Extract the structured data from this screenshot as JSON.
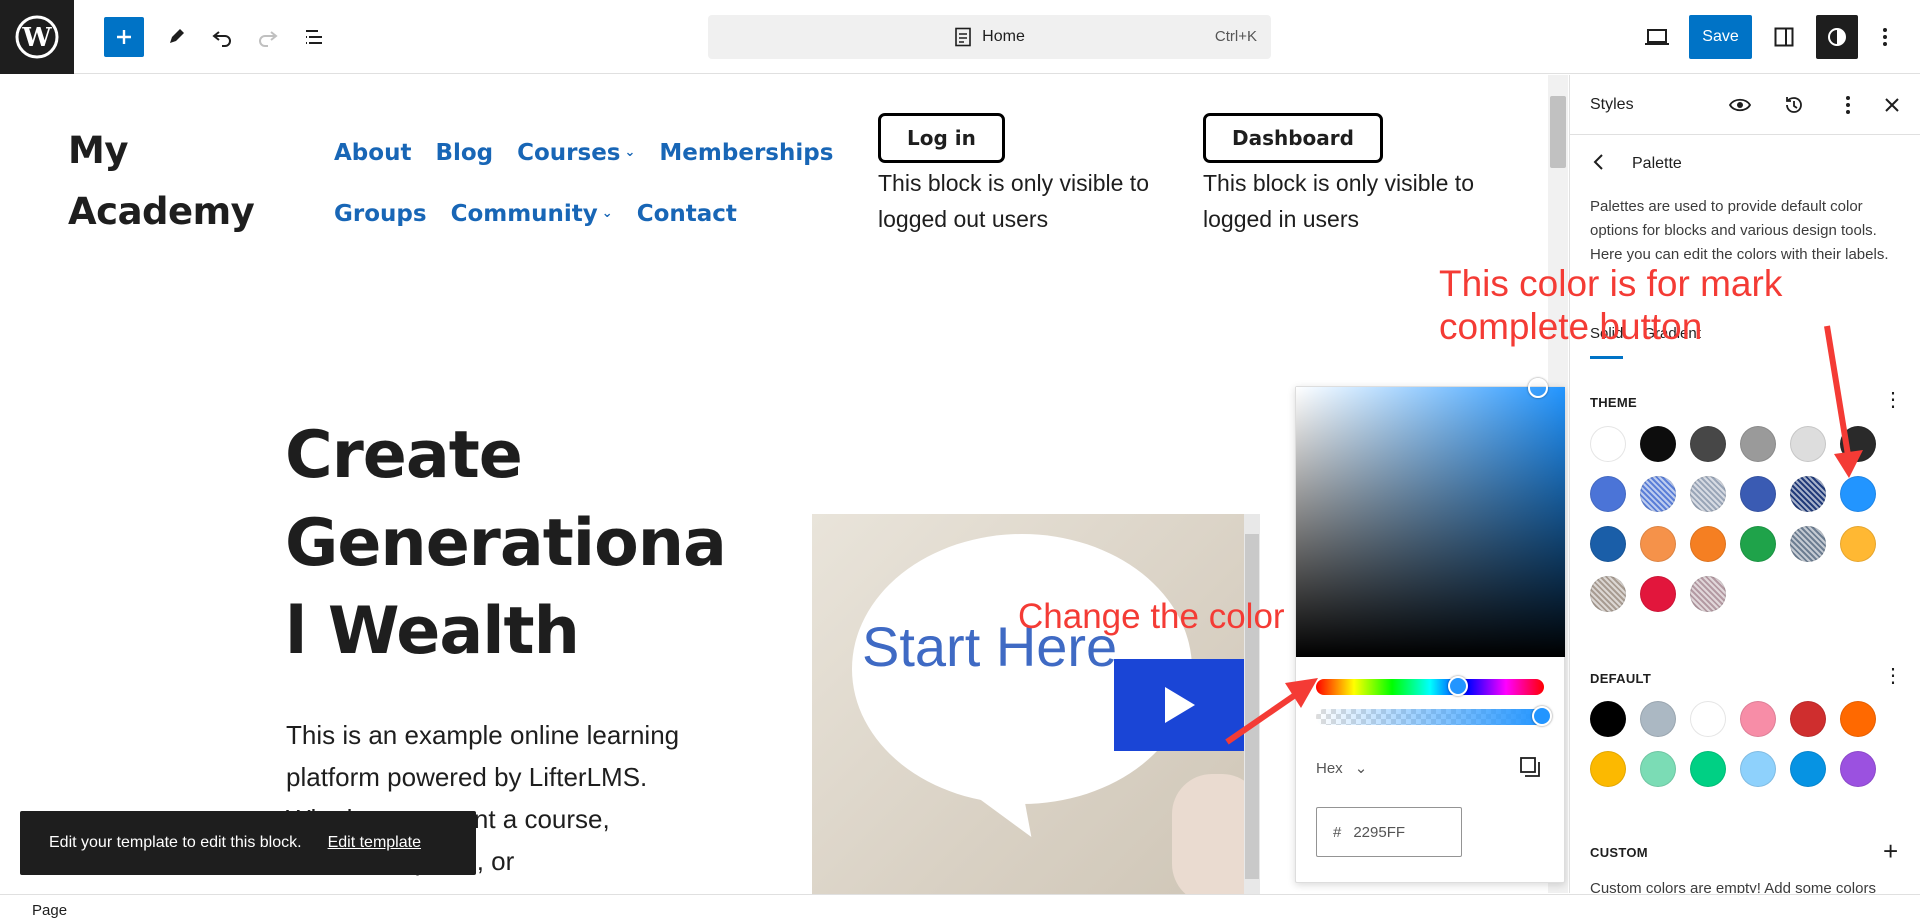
{
  "topbar": {
    "doc_title": "Home",
    "shortcut": "Ctrl+K",
    "save_label": "Save"
  },
  "site": {
    "title_line1": "My",
    "title_line2": "Academy",
    "nav_row1": [
      "About",
      "Blog",
      "Courses",
      "Memberships"
    ],
    "nav_row2": [
      "Groups",
      "Community",
      "Contact"
    ],
    "login_button": "Log in",
    "login_note_line1": "This block is only visible to",
    "login_note_line2": "logged out users",
    "dashboard_button": "Dashboard",
    "dashboard_note_line1": "This block is only visible to",
    "dashboard_note_line2": "logged in users"
  },
  "hero": {
    "title_line1": "Create",
    "title_line2": "Generationa",
    "title_line3": "l Wealth",
    "text_line1": "This is an example online learning",
    "text_line2": "platform powered by LifterLMS.",
    "text_line3": "Whether you want a course,",
    "text_line4": "membership site, or",
    "video_text": "Start Here"
  },
  "picker": {
    "format": "Hex",
    "hash": "#",
    "hex_value": "2295FF"
  },
  "sidebar": {
    "title": "Styles",
    "palette_title": "Palette",
    "palette_desc": "Palettes are used to provide default color options for blocks and various design tools. Here you can edit the colors with their labels.",
    "tab_solid": "Solid",
    "tab_gradient": "Gradient",
    "theme_label": "THEME",
    "default_label": "DEFAULT",
    "custom_label": "CUSTOM",
    "custom_desc": "Custom colors are empty! Add some colors",
    "theme_colors": [
      "#ffffff",
      "#0d0d0d",
      "#474747",
      "#9a9a9a",
      "#dddddd",
      "#2a2a2a",
      "#4b74d7",
      "#5b7fd8",
      "#9aa6b8",
      "#3a5bb3",
      "#213b7a",
      "#2295ff",
      "#1a5ea8",
      "#f5924a",
      "#f57f22",
      "#1fa34a",
      "#6d7e92",
      "#ffb833",
      "#a89c92",
      "#e2163c",
      "#b49aa3"
    ],
    "theme_hatched": [
      false,
      false,
      false,
      false,
      false,
      false,
      false,
      true,
      true,
      false,
      true,
      false,
      false,
      false,
      false,
      false,
      true,
      false,
      true,
      false,
      true
    ],
    "default_colors": [
      "#000000",
      "#abb8c3",
      "#ffffff",
      "#f78da7",
      "#cf2e2e",
      "#ff6900",
      "#fcb900",
      "#7bdcb5",
      "#00d084",
      "#8ed1fc",
      "#0693e3",
      "#9b51e0"
    ]
  },
  "snackbar": {
    "message": "Edit your template to edit this block.",
    "action": "Edit template"
  },
  "statusbar": {
    "label": "Page"
  },
  "annotations": {
    "note1_line1": "This color is for mark",
    "note1_line2": "complete button",
    "note2": "Change the color"
  },
  "colors": {
    "accent": "#0073c6",
    "annotation": "#f43b35",
    "nav_link": "#1866b6"
  }
}
